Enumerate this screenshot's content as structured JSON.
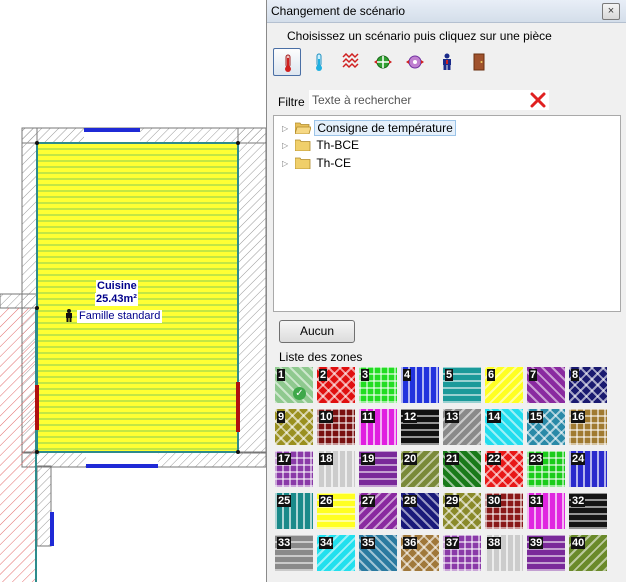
{
  "plan": {
    "room_name": "Cuisine",
    "room_area": "25.43m²",
    "occupant": "Famille standard",
    "colors": {
      "room_fill": "#ffff33",
      "room_stripe": "#86cc55",
      "wall_blue": "#1f2ad6",
      "hatch_red": "#e36a6a",
      "hatch_gray": "#9a9a9a",
      "teal": "#2e8b8b",
      "door_red": "#b01010"
    }
  },
  "dialog": {
    "title": "Changement de scénario",
    "close_label": "×",
    "instruction": "Choisissez un scénario puis cliquez sur une pièce",
    "tools": [
      {
        "name": "temperature-setpoint",
        "icon": "thermometer-red-icon",
        "active": true
      },
      {
        "name": "cold-setpoint",
        "icon": "thermometer-blue-icon",
        "active": false
      },
      {
        "name": "heating",
        "icon": "heat-waves-icon",
        "active": false
      },
      {
        "name": "ventilation",
        "icon": "ventilation-icon",
        "active": false
      },
      {
        "name": "ventilation-2",
        "icon": "fan-icon",
        "active": false
      },
      {
        "name": "occupancy",
        "icon": "person-icon",
        "active": false
      },
      {
        "name": "door",
        "icon": "door-icon",
        "active": false
      }
    ],
    "filter": {
      "label": "Filtre",
      "placeholder": "Texte à rechercher",
      "value": ""
    },
    "tree": [
      {
        "label": "Consigne de température",
        "selected": true
      },
      {
        "label": "Th-BCE",
        "selected": false
      },
      {
        "label": "Th-CE",
        "selected": false
      }
    ],
    "aucun_label": "Aucun",
    "zones_label": "Liste des zones",
    "zones": [
      {
        "num": "1",
        "color": "#8fc98f",
        "checked": true
      },
      {
        "num": "2",
        "color": "#e01010"
      },
      {
        "num": "3",
        "color": "#22dd22"
      },
      {
        "num": "4",
        "color": "#2233dd"
      },
      {
        "num": "5",
        "color": "#1b9a9a"
      },
      {
        "num": "6",
        "color": "#ffff22"
      },
      {
        "num": "7",
        "color": "#8a2aa0"
      },
      {
        "num": "8",
        "color": "#1a1a70"
      },
      {
        "num": "9",
        "color": "#9a9020"
      },
      {
        "num": "10",
        "color": "#7a1010"
      },
      {
        "num": "11",
        "color": "#e020e0"
      },
      {
        "num": "12",
        "color": "#111111"
      },
      {
        "num": "13",
        "color": "#8a8a8a"
      },
      {
        "num": "14",
        "color": "#22ddee"
      },
      {
        "num": "15",
        "color": "#2a8aa8"
      },
      {
        "num": "16",
        "color": "#a07a30"
      },
      {
        "num": "17",
        "color": "#8a3aa8"
      },
      {
        "num": "18",
        "color": "#cccccc"
      },
      {
        "num": "19",
        "color": "#7a2a9a"
      },
      {
        "num": "20",
        "color": "#7a8a3a"
      },
      {
        "num": "21",
        "color": "#1a7a1a"
      },
      {
        "num": "22",
        "color": "#e81818"
      },
      {
        "num": "23",
        "color": "#1acc1a"
      },
      {
        "num": "24",
        "color": "#2a2acc"
      },
      {
        "num": "25",
        "color": "#1a8a8a"
      },
      {
        "num": "26",
        "color": "#ffff22"
      },
      {
        "num": "27",
        "color": "#8a2aa0"
      },
      {
        "num": "28",
        "color": "#1a1a7a"
      },
      {
        "num": "29",
        "color": "#8a8a2a"
      },
      {
        "num": "30",
        "color": "#8a1818"
      },
      {
        "num": "31",
        "color": "#e028e0"
      },
      {
        "num": "32",
        "color": "#151515"
      },
      {
        "num": "33",
        "color": "#8a8a8a"
      },
      {
        "num": "34",
        "color": "#22e0ee"
      },
      {
        "num": "35",
        "color": "#2a7aa0"
      },
      {
        "num": "36",
        "color": "#a0783a"
      },
      {
        "num": "37",
        "color": "#8a3aa8"
      },
      {
        "num": "38",
        "color": "#cccccc"
      },
      {
        "num": "39",
        "color": "#7a2a9a"
      },
      {
        "num": "40",
        "color": "#6a8a2a"
      }
    ]
  }
}
